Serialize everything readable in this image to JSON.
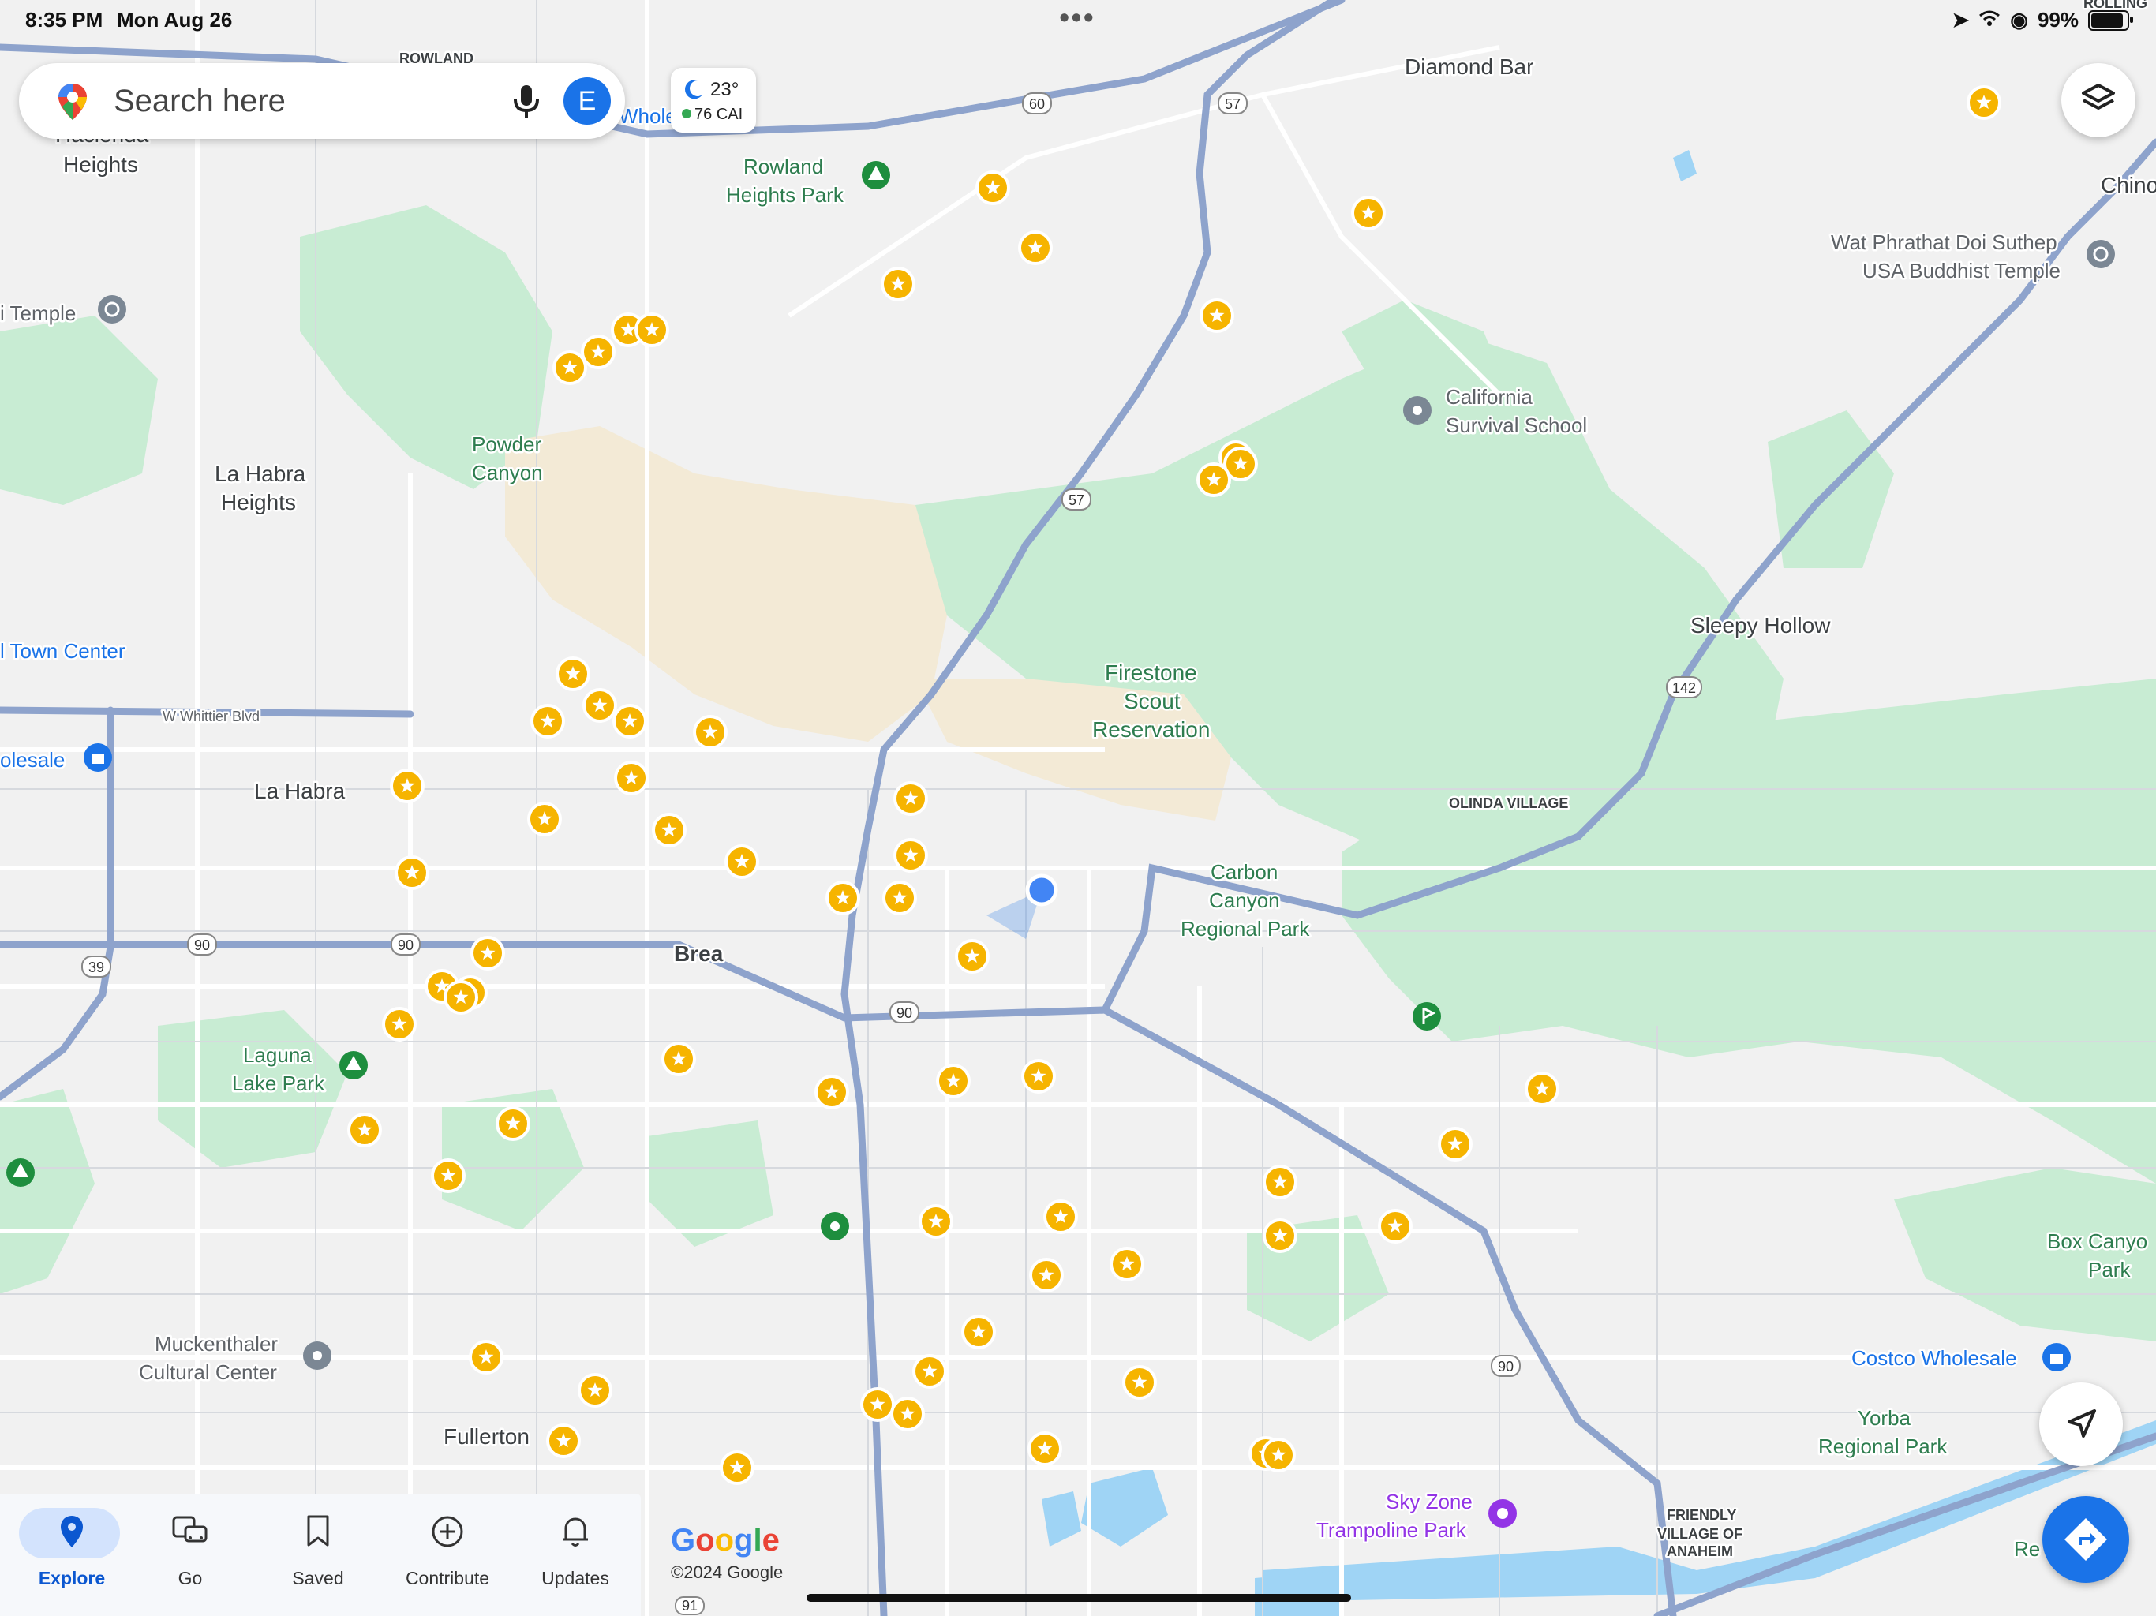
{
  "status_bar": {
    "time": "8:35 PM",
    "date": "Mon Aug 26",
    "battery": "99%",
    "battery_level": 0.99
  },
  "search": {
    "placeholder": "Search here",
    "avatar_letter": "E"
  },
  "weather": {
    "temperature": "23°",
    "aqi": "76 CAI"
  },
  "map_labels": {
    "rowland": "ROWLAND",
    "rolling": "ROLLING",
    "hacienda": "Hacienda",
    "hacienda_heights": "Heights",
    "whole": "Whole",
    "rowland_heights_park_1": "Rowland",
    "rowland_heights_park_2": "Heights Park",
    "diamond_bar": "Diamond Bar",
    "chino": "Chino",
    "wat_1": "Wat Phrathat Doi Suthep",
    "wat_2": "USA Buddhist Temple",
    "temple_left": "i Temple",
    "california_survival_1": "California",
    "california_survival_2": "Survival School",
    "powder_canyon_1": "Powder",
    "powder_canyon_2": "Canyon",
    "la_habra_heights_1": "La Habra",
    "la_habra_heights_2": "Heights",
    "sleepy_hollow": "Sleepy Hollow",
    "town_center": "l Town Center",
    "firestone_1": "Firestone",
    "firestone_2": "Scout",
    "firestone_3": "Reservation",
    "whittier_blvd": "W Whittier Blvd",
    "wholesale_left": "olesale",
    "olinda_village": "OLINDA VILLAGE",
    "la_habra": "La Habra",
    "carbon_canyon_1": "Carbon",
    "carbon_canyon_2": "Canyon",
    "carbon_canyon_3": "Regional Park",
    "brea": "Brea",
    "laguna_lake_1": "Laguna",
    "laguna_lake_2": "Lake Park",
    "box_canyon_1": "Box Canyo",
    "box_canyon_2": "Park",
    "muckenthaler_1": "Muckenthaler",
    "muckenthaler_2": "Cultural Center",
    "costco": "Costco Wholesale",
    "yorba_1": "Yorba",
    "yorba_2": "Regional Park",
    "fullerton": "Fullerton",
    "sky_zone_1": "Sky Zone",
    "sky_zone_2": "Trampoline Park",
    "friendly_1": "FRIENDLY",
    "friendly_2": "VILLAGE OF",
    "friendly_3": "ANAHEIM",
    "re": "Re"
  },
  "highway_shields": {
    "h60": "60",
    "h57a": "57",
    "h57b": "57",
    "h142": "142",
    "h90a": "90",
    "h90b": "90",
    "h39": "39",
    "h90c": "90",
    "h90d": "90",
    "h91": "91"
  },
  "bottom_nav": {
    "explore": "Explore",
    "go": "Go",
    "saved": "Saved",
    "contribute": "Contribute",
    "updates": "Updates"
  },
  "attribution": {
    "logo": "Google",
    "copyright": "©2024 Google"
  },
  "colors": {
    "accent": "#1a73e8",
    "park": "#c8ecd3",
    "star": "#f6b400",
    "highway": "#8ea3cc",
    "water": "#9fd4f5"
  }
}
